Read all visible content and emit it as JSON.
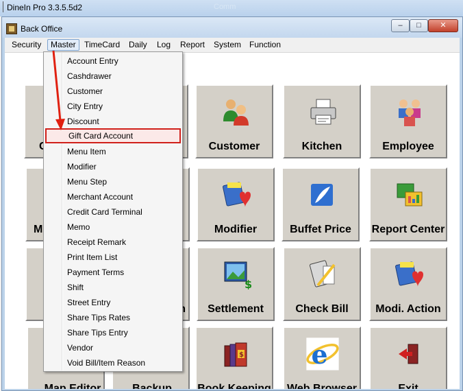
{
  "outer_window": {
    "title": "DineIn Pro 3.3.5.5d2",
    "faded_text": "Comm"
  },
  "window": {
    "title": "Back Office",
    "controls": {
      "minimize": "–",
      "maximize": "□",
      "close": "✕"
    }
  },
  "menubar": {
    "items": [
      {
        "label": "Security"
      },
      {
        "label": "Master"
      },
      {
        "label": "TimeCard"
      },
      {
        "label": "Daily"
      },
      {
        "label": "Log"
      },
      {
        "label": "Report"
      },
      {
        "label": "System"
      },
      {
        "label": "Function"
      }
    ],
    "active": "Master"
  },
  "master_menu": {
    "items": [
      {
        "label": "Account Entry"
      },
      {
        "label": "Cashdrawer"
      },
      {
        "label": "Customer"
      },
      {
        "label": "City Entry"
      },
      {
        "label": "Discount"
      },
      {
        "label": "Gift Card Account"
      },
      {
        "label": "Menu Item"
      },
      {
        "label": "Modifier"
      },
      {
        "label": "Menu Step"
      },
      {
        "label": "Merchant Account"
      },
      {
        "label": "Credit Card Terminal"
      },
      {
        "label": "Memo"
      },
      {
        "label": "Receipt Remark"
      },
      {
        "label": "Print Item List"
      },
      {
        "label": "Payment Terms"
      },
      {
        "label": "Shift"
      },
      {
        "label": "Street Entry"
      },
      {
        "label": "Share Tips Rates"
      },
      {
        "label": "Share Tips Entry"
      },
      {
        "label": "Vendor"
      },
      {
        "label": "Void Bill/Item Reason"
      }
    ],
    "highlighted": "Gift Card Account",
    "highlight_color": "#d0201a"
  },
  "tiles": [
    {
      "label": "C",
      "icon": "partially-hidden"
    },
    {
      "label": "",
      "icon": "hidden"
    },
    {
      "label": "Customer",
      "icon": "people-icon"
    },
    {
      "label": "Kitchen",
      "icon": "printer-icon"
    },
    {
      "label": "Employee",
      "icon": "employees-icon"
    },
    {
      "label": "Me",
      "icon": "partially-hidden"
    },
    {
      "label": "",
      "icon": "hidden"
    },
    {
      "label": "Modifier",
      "icon": "menu-heart-icon"
    },
    {
      "label": "Buffet Price",
      "icon": "quill-icon"
    },
    {
      "label": "Report Center",
      "icon": "report-windows-icon"
    },
    {
      "label": "S",
      "icon": "partially-hidden"
    },
    {
      "label": "n",
      "icon": "partially-hidden"
    },
    {
      "label": "Settlement",
      "icon": "settlement-icon"
    },
    {
      "label": "Check Bill",
      "icon": "calculator-icon"
    },
    {
      "label": "Modi. Action",
      "icon": "menu-heart-icon"
    },
    {
      "label": "Map Editor",
      "icon": "partially-hidden"
    },
    {
      "label": "Backup",
      "icon": "partially-hidden"
    },
    {
      "label": "Book Keeping",
      "icon": "books-icon"
    },
    {
      "label": "Web Browser",
      "icon": "internet-explorer-icon"
    },
    {
      "label": "Exit",
      "icon": "exit-door-icon"
    }
  ],
  "annotation": {
    "arrow_color": "#e02010"
  }
}
